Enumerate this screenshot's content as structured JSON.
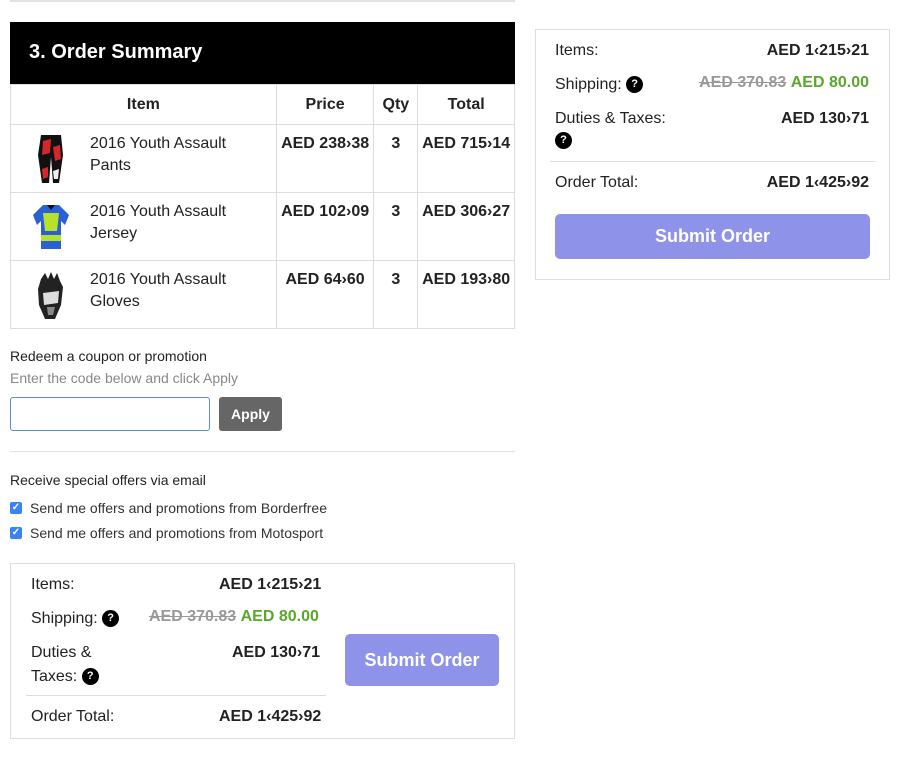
{
  "section": {
    "title": "3. Order Summary"
  },
  "table": {
    "headers": {
      "item": "Item",
      "price": "Price",
      "qty": "Qty",
      "total": "Total"
    },
    "rows": [
      {
        "name": "2016 Youth Assault Pants",
        "price": "AED 238›38",
        "qty": "3",
        "total": "AED 715›14",
        "icon": "pants-icon"
      },
      {
        "name": "2016 Youth Assault Jersey",
        "price": "AED 102›09",
        "qty": "3",
        "total": "AED 306›27",
        "icon": "jersey-icon"
      },
      {
        "name": "2016 Youth Assault Gloves",
        "price": "AED 64›60",
        "qty": "3",
        "total": "AED 193›80",
        "icon": "gloves-icon"
      }
    ]
  },
  "coupon": {
    "title": "Redeem a coupon or promotion",
    "hint": "Enter the code below and click Apply",
    "input_value": "",
    "apply_label": "Apply"
  },
  "offers": {
    "title": "Receive special offers via email",
    "items": [
      {
        "label": "Send me offers and promotions from Borderfree",
        "checked": true
      },
      {
        "label": "Send me offers and promotions from Motosport",
        "checked": true
      }
    ]
  },
  "summary": {
    "items_label": "Items:",
    "items_value": "AED 1‹215›21",
    "shipping_label": "Shipping:",
    "shipping_old": "AED 370.83",
    "shipping_new": "AED 80.00",
    "duties_label": "Duties & Taxes:",
    "duties_label_line1": "Duties &",
    "duties_label_line2": "Taxes:",
    "duties_value": "AED 130›71",
    "total_label": "Order Total:",
    "total_value": "AED 1‹425›92",
    "help_glyph": "?",
    "submit_label": "Submit Order"
  },
  "colors": {
    "accent": "#8e92e9",
    "discount": "#5aa72b",
    "header_bg": "#000000"
  }
}
